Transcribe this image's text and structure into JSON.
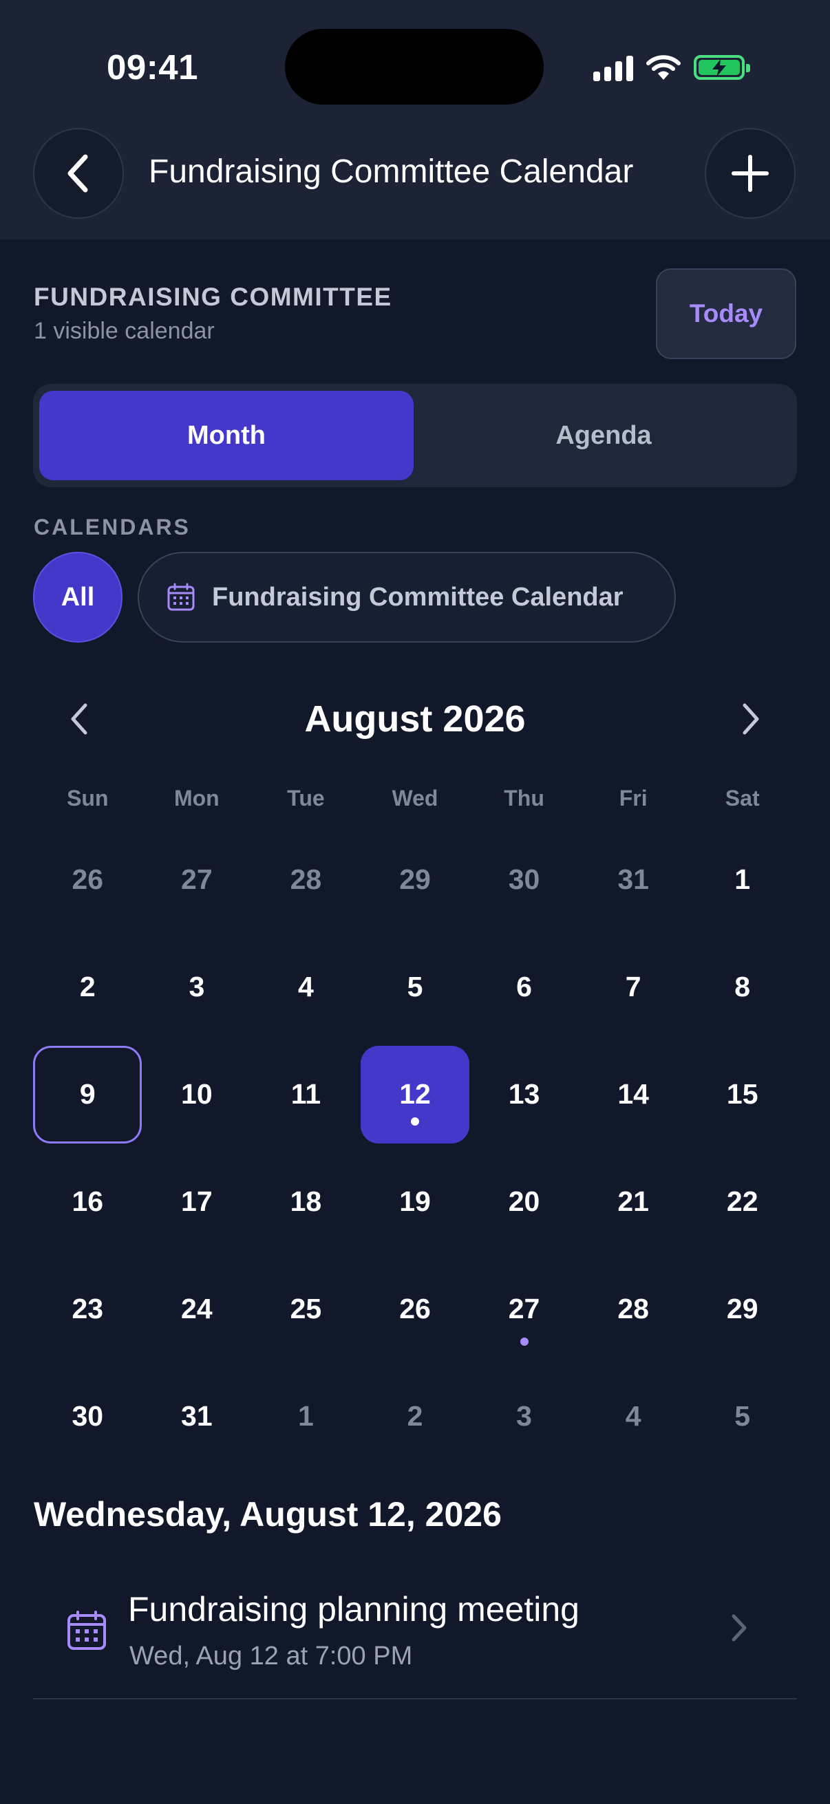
{
  "status_bar": {
    "time": "09:41"
  },
  "header": {
    "title": "Fundraising Committee Calendar"
  },
  "committee": {
    "name": "FUNDRAISING COMMITTEE",
    "subtitle": "1 visible calendar",
    "today_label": "Today"
  },
  "view_toggle": {
    "month_label": "Month",
    "agenda_label": "Agenda",
    "selected": "Month"
  },
  "calendars": {
    "section_label": "CALENDARS",
    "all_label": "All",
    "calendar_name": "Fundraising Committee Calendar"
  },
  "month_view": {
    "title": "August 2026",
    "weekdays": [
      "Sun",
      "Mon",
      "Tue",
      "Wed",
      "Thu",
      "Fri",
      "Sat"
    ],
    "days": [
      {
        "label": "26",
        "muted": true
      },
      {
        "label": "27",
        "muted": true
      },
      {
        "label": "28",
        "muted": true
      },
      {
        "label": "29",
        "muted": true
      },
      {
        "label": "30",
        "muted": true
      },
      {
        "label": "31",
        "muted": true
      },
      {
        "label": "1"
      },
      {
        "label": "2"
      },
      {
        "label": "3"
      },
      {
        "label": "4"
      },
      {
        "label": "5"
      },
      {
        "label": "6"
      },
      {
        "label": "7"
      },
      {
        "label": "8"
      },
      {
        "label": "9",
        "today": true
      },
      {
        "label": "10"
      },
      {
        "label": "11"
      },
      {
        "label": "12",
        "selected": true,
        "event": true
      },
      {
        "label": "13"
      },
      {
        "label": "14"
      },
      {
        "label": "15"
      },
      {
        "label": "16"
      },
      {
        "label": "17"
      },
      {
        "label": "18"
      },
      {
        "label": "19"
      },
      {
        "label": "20"
      },
      {
        "label": "21"
      },
      {
        "label": "22"
      },
      {
        "label": "23"
      },
      {
        "label": "24"
      },
      {
        "label": "25"
      },
      {
        "label": "26"
      },
      {
        "label": "27",
        "event": true
      },
      {
        "label": "28"
      },
      {
        "label": "29"
      },
      {
        "label": "30"
      },
      {
        "label": "31"
      },
      {
        "label": "1",
        "muted": true
      },
      {
        "label": "2",
        "muted": true
      },
      {
        "label": "3",
        "muted": true
      },
      {
        "label": "4",
        "muted": true
      },
      {
        "label": "5",
        "muted": true
      }
    ]
  },
  "selected_day": {
    "heading": "Wednesday, August 12, 2026",
    "events": [
      {
        "title": "Fundraising planning meeting",
        "time": "Wed, Aug 12 at 7:00 PM",
        "icon": "calendar-icon"
      }
    ]
  },
  "colors": {
    "accent": "#4338ca",
    "accent_light": "#a78bfa",
    "background": "#111829",
    "header_bg": "#1b2335"
  }
}
